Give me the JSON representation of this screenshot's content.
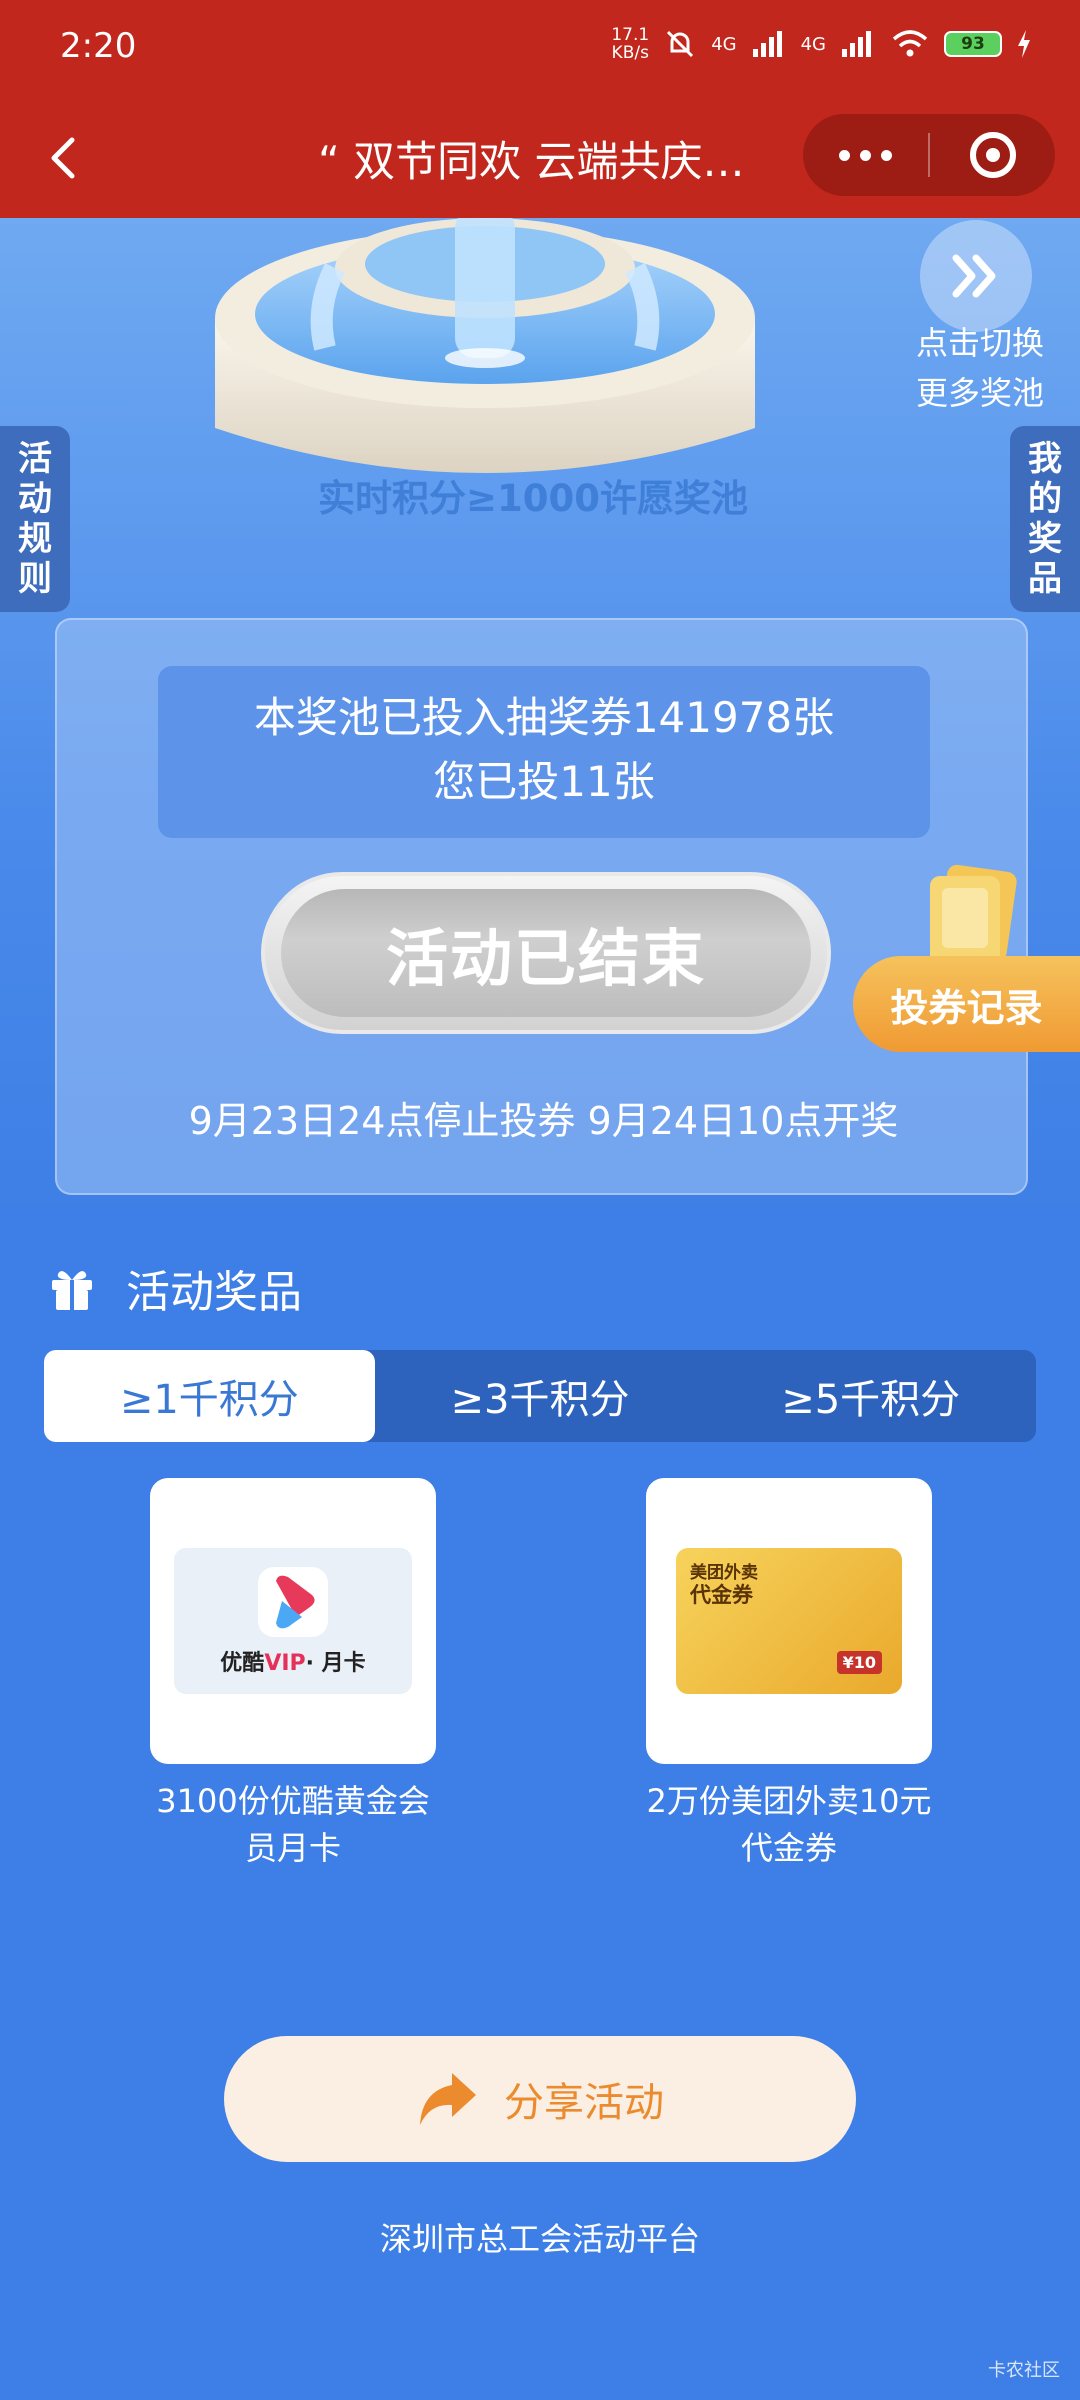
{
  "status_bar": {
    "time": "2:20",
    "net_speed_value": "17.1",
    "net_speed_unit": "KB/s",
    "signal1": "4G",
    "signal2": "4G",
    "battery": "93"
  },
  "nav": {
    "title": "“ 双节同欢 云端共庆…"
  },
  "hero": {
    "pool_title": "实时积分≥1000许愿奖池",
    "switch_label_1": "点击切换",
    "switch_label_2": "更多奖池",
    "rules_tab": "活动规则",
    "my_prizes_tab": "我的奖品"
  },
  "panel": {
    "total_line": "本奖池已投入抽奖券141978张",
    "mine_line": "您已投11张",
    "end_button": "活动已结束",
    "schedule": "9月23日24点停止投券 9月24日10点开奖",
    "record_button": "投券记录"
  },
  "prizes": {
    "section_title": "活动奖品",
    "tabs": [
      {
        "label": "≥1千积分",
        "active": true
      },
      {
        "label": "≥3千积分",
        "active": false
      },
      {
        "label": "≥5千积分",
        "active": false
      }
    ],
    "items": [
      {
        "name_line1": "3100份优酷黄金会",
        "name_line2": "员月卡",
        "image_text_a": "优酷",
        "image_text_b": "VIP",
        "image_text_c": "· 月卡"
      },
      {
        "name_line1": "2万份美团外卖10元",
        "name_line2": "代金券",
        "image_text_a": "美团外卖",
        "image_text_b": "代金券",
        "image_text_c": "¥10"
      }
    ]
  },
  "share_button": "分享活动",
  "footer": "深圳市总工会活动平台",
  "watermark": "卡农社区",
  "colors": {
    "header_red": "#c1271d",
    "page_blue": "#3d7fe6",
    "share_orange": "#ec8a2e"
  },
  "icons": {
    "back": "chevron-left-icon",
    "more": "more-dots-icon",
    "close": "target-close-icon",
    "switch": "double-chevron-right-icon",
    "gift": "gift-icon",
    "share": "share-arrow-icon"
  }
}
